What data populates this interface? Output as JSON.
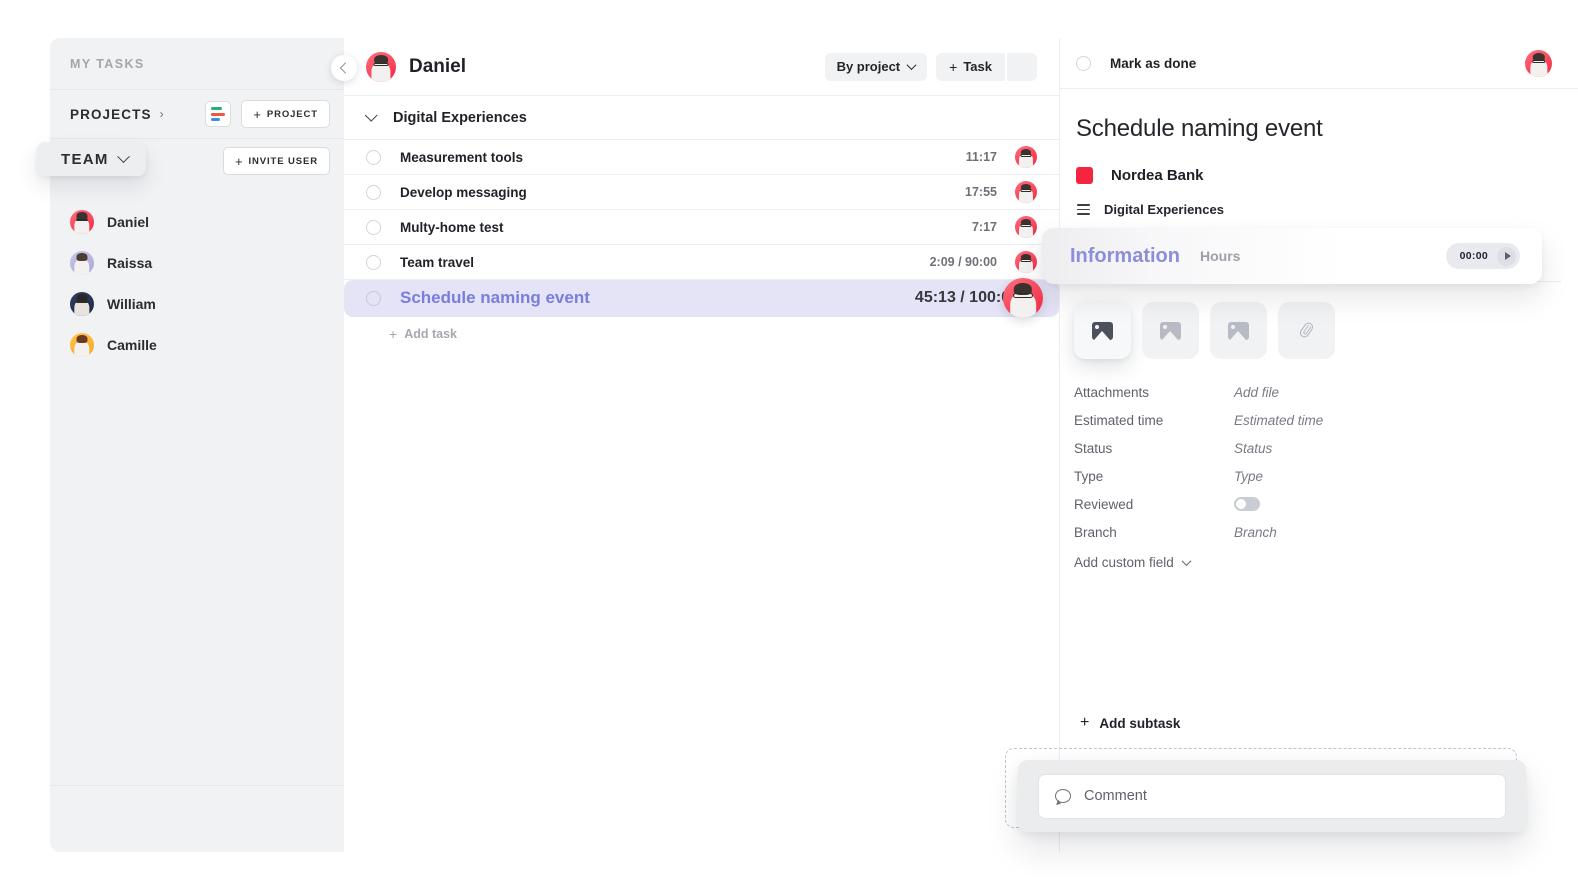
{
  "sidebar": {
    "my_tasks_label": "MY TASKS",
    "projects_label": "PROJECTS",
    "project_button": "PROJECT",
    "team_label": "TEAM",
    "invite_button": "INVITE USER",
    "members": [
      {
        "name": "Daniel",
        "avatar_color": "#f5243f"
      },
      {
        "name": "Raissa",
        "avatar_color": "#a9a5d6"
      },
      {
        "name": "William",
        "avatar_color": "#1d2a45"
      },
      {
        "name": "Camille",
        "avatar_color": "#f5a623"
      }
    ]
  },
  "main": {
    "user_name": "Daniel",
    "group_by_label": "By project",
    "add_task_button": "Task",
    "group": {
      "name": "Digital Experiences"
    },
    "tasks": [
      {
        "name": "Measurement tools",
        "time": "11:17",
        "selected": false
      },
      {
        "name": "Develop messaging",
        "time": "17:55",
        "selected": false
      },
      {
        "name": "Multy-home test",
        "time": "7:17",
        "selected": false
      },
      {
        "name": "Team travel",
        "time": "2:09 / 90:00",
        "selected": false
      },
      {
        "name": "Schedule naming event",
        "time": "45:13 / 100:00",
        "selected": true
      }
    ],
    "add_task_label": "Add task"
  },
  "detail": {
    "mark_as_done": "Mark as done",
    "title": "Schedule naming event",
    "project": "Nordea Bank",
    "project_color": "#f5243f",
    "section": "Digital Experiences",
    "tabs": {
      "active": "Information",
      "inactive": "Hours"
    },
    "timer": "00:00",
    "fields": [
      {
        "label": "Attachments",
        "value": "Add file",
        "type": "text"
      },
      {
        "label": "Estimated time",
        "value": "Estimated time",
        "type": "text"
      },
      {
        "label": "Status",
        "value": "Status",
        "type": "text"
      },
      {
        "label": "Type",
        "value": "Type",
        "type": "text"
      },
      {
        "label": "Reviewed",
        "value": "",
        "type": "toggle"
      },
      {
        "label": "Branch",
        "value": "Branch",
        "type": "text"
      }
    ],
    "add_custom_field": "Add custom field",
    "add_subtask": "Add subtask",
    "comment_placeholder": "Comment"
  }
}
